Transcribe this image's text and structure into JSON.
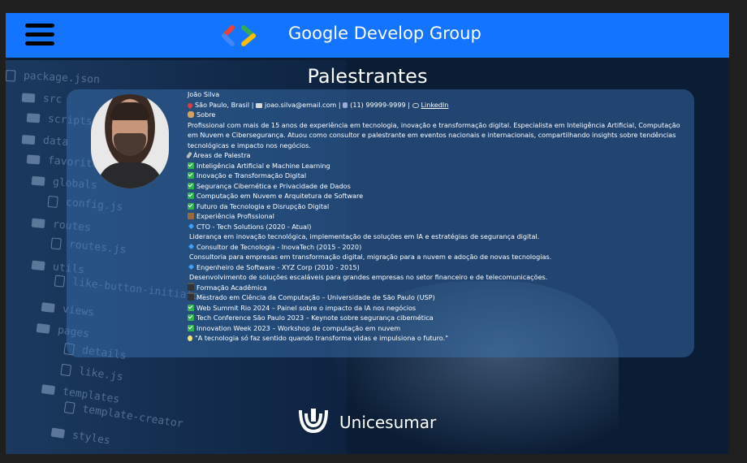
{
  "header": {
    "title": "Google Develop Group",
    "menu_icon": "hamburger-menu-icon",
    "logo_icon": "gdg-logo-icon"
  },
  "page": {
    "title": "Palestrantes"
  },
  "background_words": [
    "package.json",
    "src",
    "scripts",
    "data",
    "favorites",
    "globals",
    "config.js",
    "routes",
    "routes.js",
    "utils",
    "like-button-initiator",
    "views",
    "pages",
    "details",
    "like.js",
    "templates",
    "template-creator",
    "styles"
  ],
  "speaker": {
    "name": "João Silva",
    "location": "São Paulo, Brasil",
    "email": "joao.silva@email.com",
    "phone": "(11) 99999-9999",
    "linkedin": "LinkedIn",
    "about_heading": "Sobre",
    "about": "Profissional com mais de 15 anos de experiência em tecnologia, inovação e transformação digital. Especialista em Inteligência Artificial, Computação em Nuvem e Cibersegurança. Atuou como consultor e palestrante em eventos nacionais e internacionais, compartilhando insights sobre tendências tecnológicas e impacto nos negócios.",
    "areas_heading": "Áreas de Palestra",
    "areas": [
      "Inteligência Artificial e Machine Learning",
      "Inovação e Transformação Digital",
      "Segurança Cibernética e Privacidade de Dados",
      "Computação em Nuvem e Arquitetura de Software",
      "Futuro da Tecnologia e Disrupção Digital"
    ],
    "experience_heading": "Experiência Profissional",
    "experience": [
      {
        "role": "CTO - Tech Solutions (2020 - Atual)",
        "desc": "Liderança em inovação tecnológica, implementação de soluções em IA e estratégias de segurança digital."
      },
      {
        "role": "Consultor de Tecnologia - InovaTech (2015 - 2020)",
        "desc": "Consultoria para empresas em transformação digital, migração para a nuvem e adoção de novas tecnologias."
      },
      {
        "role": "Engenheiro de Software - XYZ Corp (2010 - 2015)",
        "desc": "Desenvolvimento de soluções escaláveis para grandes empresas no setor financeiro e de telecomunicações."
      }
    ],
    "education_heading": "Formação Acadêmica",
    "education": "Mestrado em Ciência da Computação – Universidade de São Paulo (USP)",
    "events": [
      "Web Summit Rio 2024 – Painel sobre o impacto da IA nos negócios",
      "Tech Conference São Paulo 2023 – Keynote sobre segurança cibernética",
      "Innovation Week 2023 – Workshop de computação em nuvem"
    ],
    "quote": "\"A tecnologia só faz sentido quando transforma vidas e impulsiona o futuro.\""
  },
  "footer": {
    "name": "Unicesumar",
    "logo_icon": "unicesumar-logo-icon"
  },
  "colors": {
    "header": "#1375ff",
    "background": "#0b1d35",
    "card": "#3c78b9"
  }
}
